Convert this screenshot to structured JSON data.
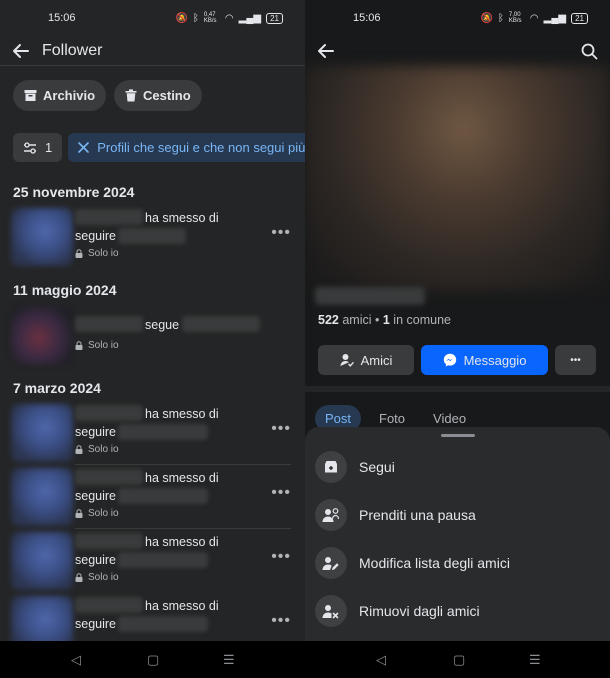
{
  "left": {
    "status": {
      "time": "15:06",
      "speed": "0,47 KB/s",
      "battery": "21"
    },
    "title": "Follower",
    "chips": [
      {
        "label": "Archivio",
        "icon": "archive-icon"
      },
      {
        "label": "Cestino",
        "icon": "trash-icon"
      }
    ],
    "filter_count": "1",
    "filter_active": "Profili che segui e che non segui più",
    "groups": [
      {
        "date": "25 novembre 2024"
      },
      {
        "date": "11 maggio 2024"
      },
      {
        "date": "7 marzo 2024"
      }
    ],
    "action_unfollow": "ha smesso di",
    "action_unfollow2": "seguire",
    "action_follow": "segue",
    "privacy": "Solo io",
    "more": "•••"
  },
  "right": {
    "status": {
      "time": "15:06",
      "speed": "7,00 KB/s",
      "battery": "21"
    },
    "friends_count": "522",
    "friends_word": "amici",
    "mutual_count": "1",
    "mutual_word": "in comune",
    "btn_friends": "Amici",
    "btn_message": "Messaggio",
    "btn_more": "•••",
    "tabs": [
      "Post",
      "Foto",
      "Video"
    ],
    "sheet_items": [
      {
        "label": "Segui",
        "icon": "follow-icon"
      },
      {
        "label": "Prenditi una pausa",
        "icon": "pause-icon"
      },
      {
        "label": "Modifica lista degli amici",
        "icon": "edit-friends-icon"
      },
      {
        "label": "Rimuovi dagli amici",
        "icon": "unfriend-icon"
      }
    ]
  },
  "colors": {
    "accent": "#0866ff",
    "chip_blue_bg": "#263951",
    "chip_blue_text": "#7ab5f6",
    "background": "#242526"
  }
}
